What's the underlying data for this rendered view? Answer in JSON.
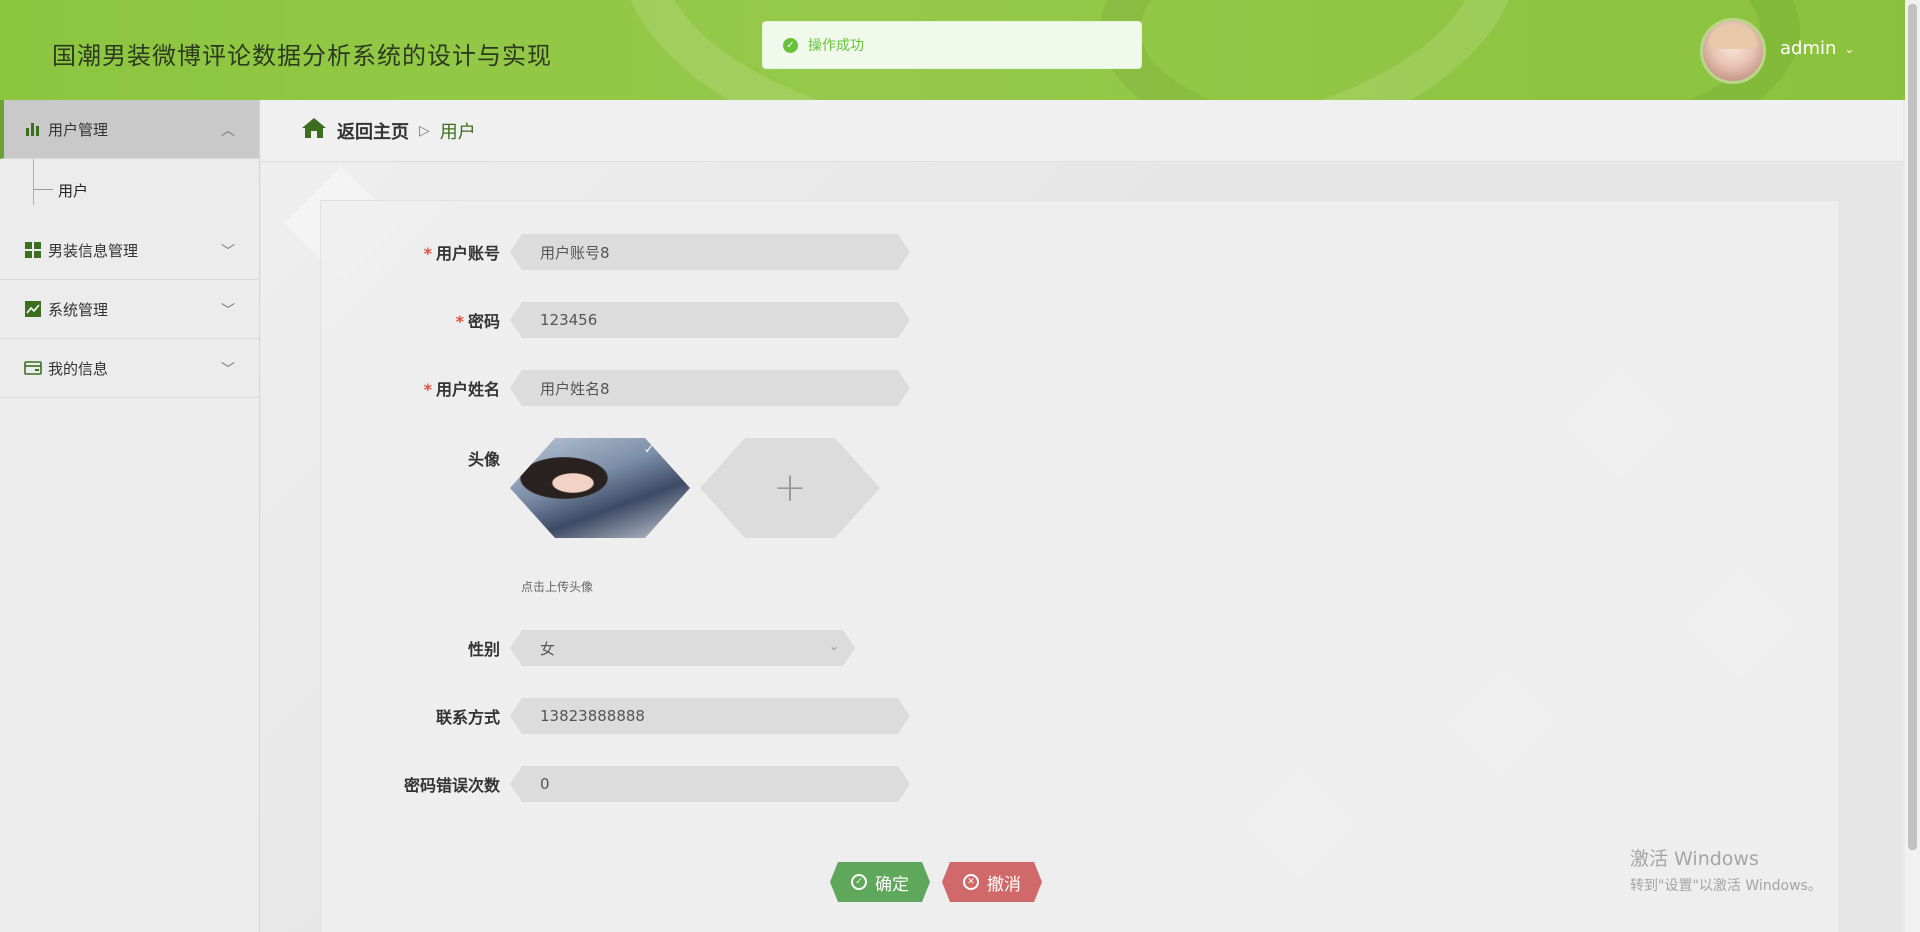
{
  "header": {
    "title": "国潮男装微博评论数据分析系统的设计与实现",
    "toast": "操作成功",
    "username": "admin"
  },
  "sidebar": {
    "items": [
      {
        "label": "用户管理",
        "icon": "bar-chart-icon",
        "expanded": true
      },
      {
        "label": "男装信息管理",
        "icon": "grid-icon",
        "expanded": false
      },
      {
        "label": "系统管理",
        "icon": "line-chart-icon",
        "expanded": false
      },
      {
        "label": "我的信息",
        "icon": "card-icon",
        "expanded": false
      }
    ],
    "sub_items": [
      {
        "label": "用户"
      }
    ]
  },
  "breadcrumb": {
    "home": "返回主页",
    "current": "用户"
  },
  "form": {
    "account": {
      "label": "用户账号",
      "value": "用户账号8"
    },
    "password": {
      "label": "密码",
      "value": "123456"
    },
    "name": {
      "label": "用户姓名",
      "value": "用户姓名8"
    },
    "avatar": {
      "label": "头像",
      "hint": "点击上传头像"
    },
    "gender": {
      "label": "性别",
      "value": "女"
    },
    "phone": {
      "label": "联系方式",
      "value": "13823888888"
    },
    "pwd_errors": {
      "label": "密码错误次数",
      "value": "0"
    },
    "submit": "确定",
    "cancel": "撤消"
  },
  "watermark": {
    "line1": "激活 Windows",
    "line2": "转到\"设置\"以激活 Windows。"
  },
  "colors": {
    "header_green": "#8cc63f",
    "accent_dark_green": "#3c6e1f",
    "ok_button": "#5fa75a",
    "cancel_button": "#d06a6a"
  }
}
